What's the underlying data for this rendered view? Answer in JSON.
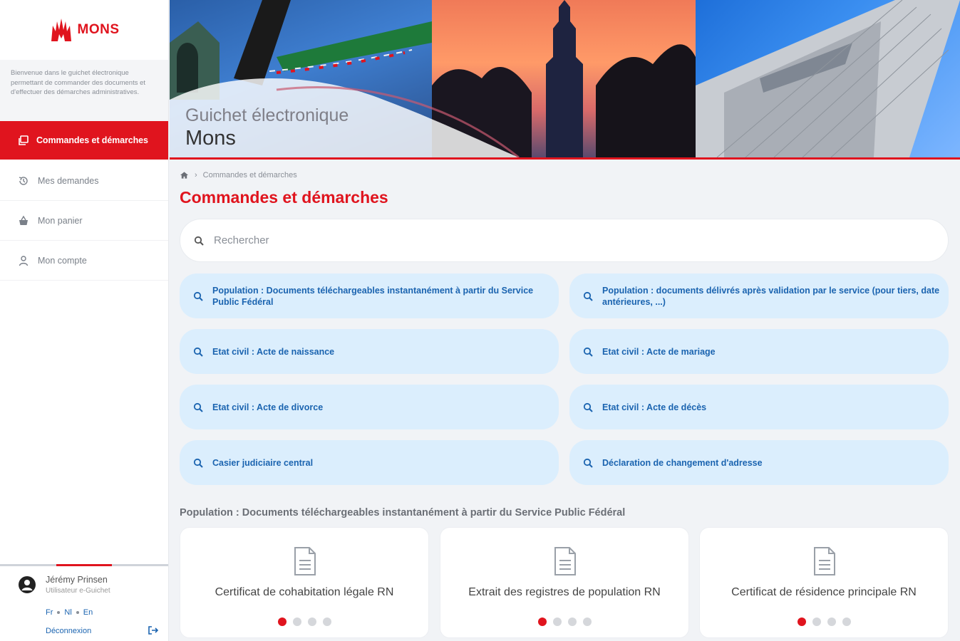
{
  "brand": {
    "logo_text": "MONS",
    "accent": "#e0141e",
    "link": "#1b64b0"
  },
  "sidebar": {
    "intro": "Bienvenue dans le guichet électronique permettant de commander des documents et d'effectuer des démarches administratives.",
    "items": [
      {
        "label": "Commandes et démarches",
        "icon": "documents-icon",
        "active": true
      },
      {
        "label": "Mes demandes",
        "icon": "history-icon"
      },
      {
        "label": "Mon panier",
        "icon": "basket-icon"
      },
      {
        "label": "Mon compte",
        "icon": "user-icon"
      }
    ],
    "user": {
      "name": "Jérémy Prinsen",
      "role": "Utilisateur e-Guichet",
      "langs": [
        "Fr",
        "Nl",
        "En"
      ],
      "logout": "Déconnexion"
    }
  },
  "banner": {
    "title": "Guichet électronique",
    "subtitle": "Mons"
  },
  "main": {
    "breadcrumb": "Commandes et démarches",
    "title": "Commandes et démarches",
    "search_placeholder": "Rechercher",
    "categories": [
      "Population : Documents téléchargeables instantanément à partir du Service Public Fédéral",
      "Population : documents délivrés après validation par le service (pour tiers, date antérieures, ...)",
      "Etat civil : Acte de naissance",
      "Etat civil : Acte de mariage",
      "Etat civil : Acte de divorce",
      "Etat civil : Acte de décès",
      "Casier judiciaire central",
      "Déclaration de changement d'adresse"
    ],
    "section_title": "Population : Documents téléchargeables instantanément à partir du Service Public Fédéral",
    "cards": [
      {
        "title": "Certificat de cohabitation légale RN",
        "active_dot": 0,
        "dots": 4
      },
      {
        "title": "Extrait des registres de population RN",
        "active_dot": 0,
        "dots": 4
      },
      {
        "title": "Certificat de résidence principale RN",
        "active_dot": 0,
        "dots": 4
      }
    ]
  }
}
